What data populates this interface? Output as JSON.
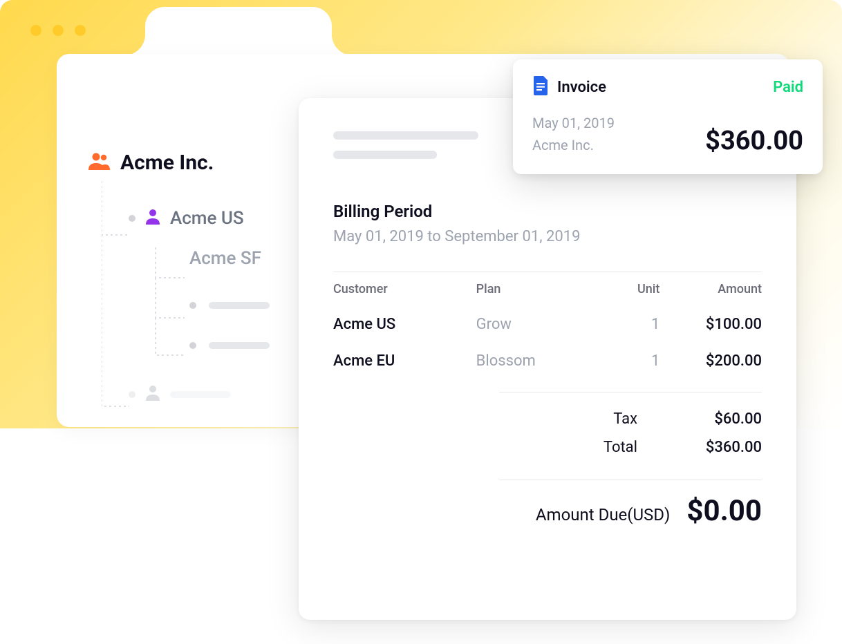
{
  "tree": {
    "root_label": "Acme Inc.",
    "child1_label": "Acme US",
    "grandchild1_label": "Acme SF"
  },
  "invoice": {
    "billing_period_title": "Billing Period",
    "billing_period_range": "May 01, 2019 to September 01, 2019",
    "headers": {
      "customer": "Customer",
      "plan": "Plan",
      "unit": "Unit",
      "amount": "Amount"
    },
    "rows": [
      {
        "customer": "Acme US",
        "plan": "Grow",
        "unit": "1",
        "amount": "$100.00"
      },
      {
        "customer": "Acme EU",
        "plan": "Blossom",
        "unit": "1",
        "amount": "$200.00"
      }
    ],
    "tax_label": "Tax",
    "tax_value": "$60.00",
    "total_label": "Total",
    "total_value": "$360.00",
    "due_label": "Amount Due(USD)",
    "due_value": "$0.00"
  },
  "popup": {
    "title": "Invoice",
    "status": "Paid",
    "date": "May 01, 2019",
    "company": "Acme Inc.",
    "amount": "$360.00"
  }
}
